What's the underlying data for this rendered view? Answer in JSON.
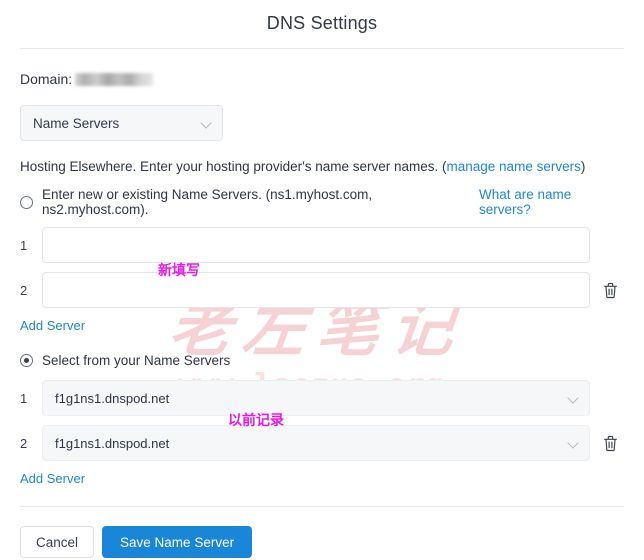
{
  "page": {
    "title": "DNS Settings",
    "domain_label": "Domain:",
    "domain_value_redacted": ""
  },
  "record_type_select": {
    "selected": "Name Servers",
    "icon": "chevron-down-icon"
  },
  "hosting": {
    "text": "Hosting Elsewhere. Enter your hosting provider's name server names. (",
    "link": "manage name servers",
    "text_after": ")"
  },
  "options": {
    "enter_new": {
      "label": "Enter new or existing Name Servers. (ns1.myhost.com, ns2.myhost.com).",
      "help_link": "What are name servers?",
      "checked": false
    },
    "select_existing": {
      "label": "Select from your Name Servers",
      "checked": true
    }
  },
  "new_servers": {
    "rows": [
      {
        "index": "1",
        "value": "",
        "placeholder": "",
        "has_delete": false
      },
      {
        "index": "2",
        "value": "",
        "placeholder": "",
        "has_delete": true
      }
    ],
    "add_label": "Add Server",
    "delete_icon": "trash-icon"
  },
  "existing_servers": {
    "rows": [
      {
        "index": "1",
        "value": "f1g1ns1.dnspod.net",
        "has_delete": false
      },
      {
        "index": "2",
        "value": "f1g1ns1.dnspod.net",
        "has_delete": true
      }
    ],
    "add_label": "Add Server",
    "dropdown_icon": "chevron-down-icon",
    "delete_icon": "trash-icon"
  },
  "footer": {
    "cancel_label": "Cancel",
    "save_label": "Save Name Server"
  },
  "annotations": {
    "new_entry": "新填写",
    "previous_record": "以前记录",
    "color": "#e61ae6"
  },
  "watermark": {
    "brand_cn": "老左笔记",
    "site_url": "www.laozuo.org",
    "color": "#f6d2d4"
  },
  "colors": {
    "primary_button": "#1a86d8",
    "link": "#1f87d8",
    "title": "#32384a",
    "border": "#e4e6ea"
  }
}
